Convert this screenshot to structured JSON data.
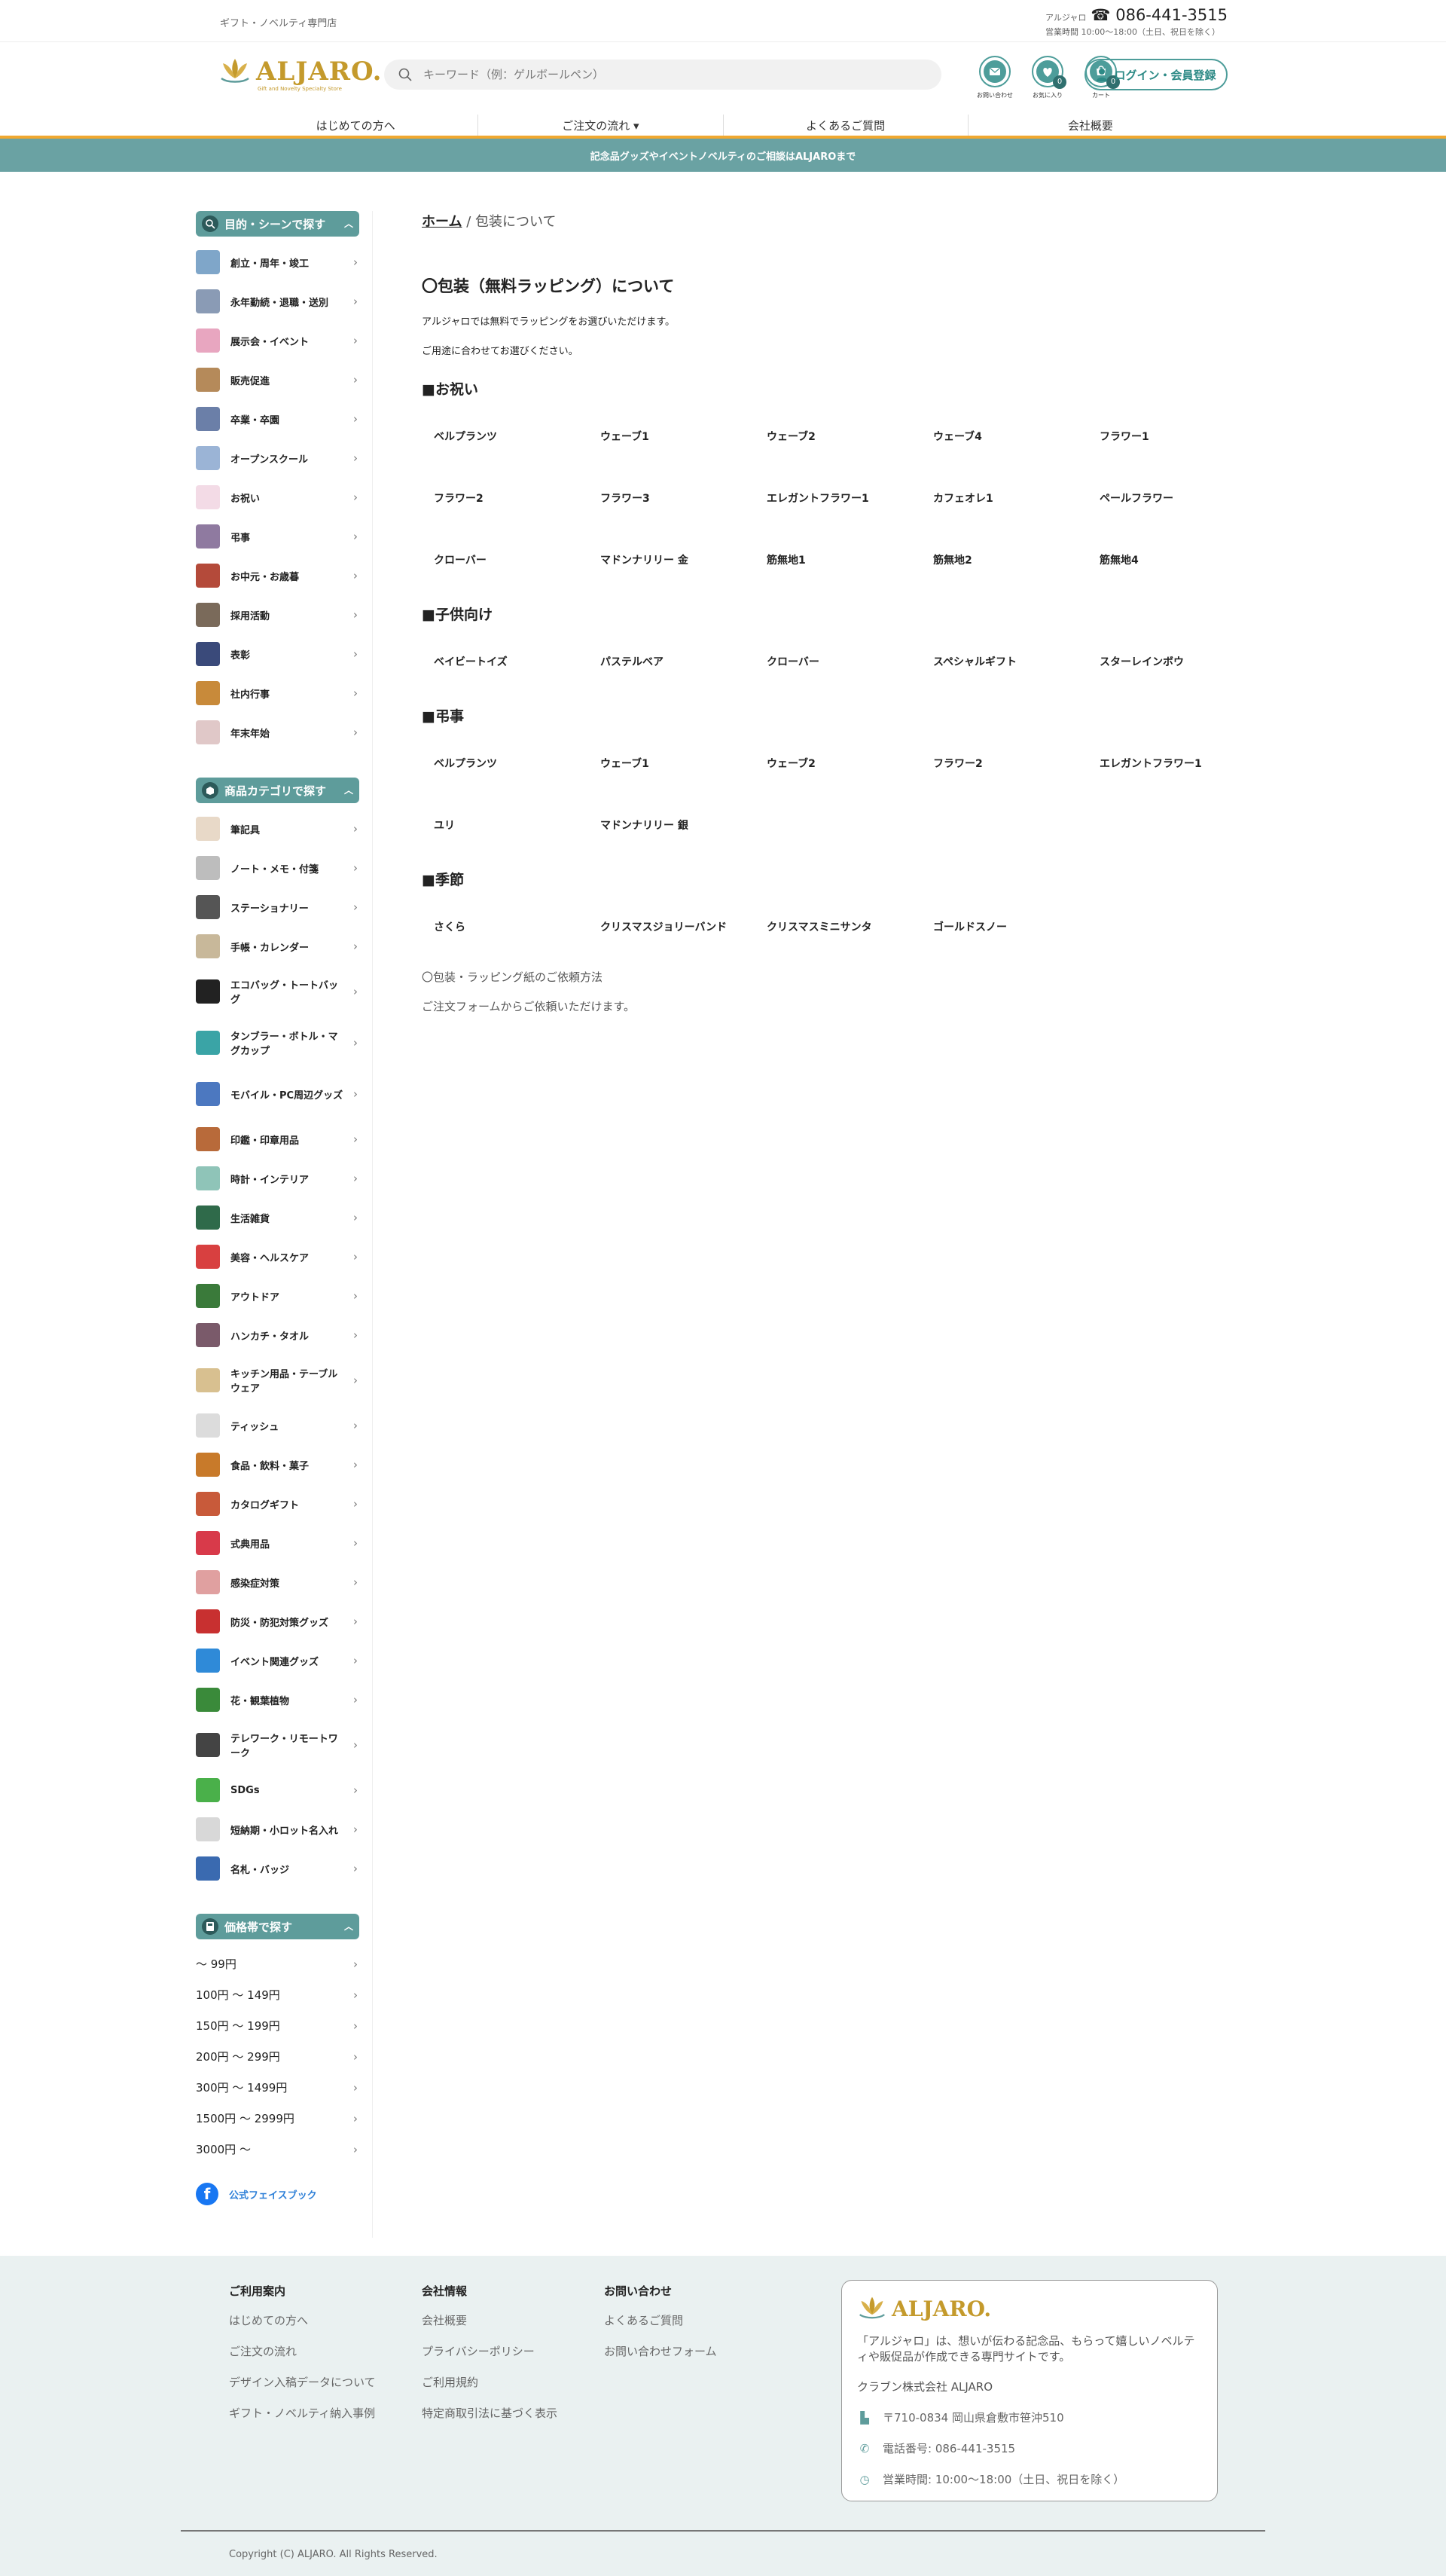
{
  "topbar": {
    "tagline": "ギフト・ノベルティ専門店",
    "phone_prefix": "アルジャロ",
    "phone": "☎ 086-441-3515",
    "hours": "営業時間 10:00〜18:00（土日、祝日を除く）"
  },
  "header": {
    "logo_text": "ALJARO.",
    "logo_sub": "Gift and Novelty Specialty Store",
    "search_placeholder": "キーワード（例：ゲルボールペン）",
    "icons": [
      {
        "label": "お問い合わせ",
        "icon": "mail-icon"
      },
      {
        "label": "お気に入り",
        "icon": "heart-icon",
        "count": "0"
      },
      {
        "label": "カート",
        "icon": "cart-icon",
        "count": "0"
      }
    ],
    "login_label": "ログイン・会員登録"
  },
  "nav": [
    "はじめての方へ",
    "ご注文の流れ ▾",
    "よくあるご質問",
    "会社概要"
  ],
  "banner": "記念品グッズやイベントノベルティのご相談はALJAROまで",
  "sidebar": {
    "scene_title": "目的・シーンで探す",
    "scenes": [
      "創立・周年・竣工",
      "永年勤続・退職・送別",
      "展示会・イベント",
      "販売促進",
      "卒業・卒園",
      "オープンスクール",
      "お祝い",
      "弔事",
      "お中元・お歳暮",
      "採用活動",
      "表彰",
      "社内行事",
      "年末年始"
    ],
    "category_title": "商品カテゴリで探す",
    "categories": [
      "筆記具",
      "ノート・メモ・付箋",
      "ステーショナリー",
      "手帳・カレンダー",
      "エコバッグ・トートバッグ",
      "タンブラー・ボトル・マグカップ",
      "モバイル・PC周辺グッズ",
      "印鑑・印章用品",
      "時計・インテリア",
      "生活雑貨",
      "美容・ヘルスケア",
      "アウトドア",
      "ハンカチ・タオル",
      "キッチン用品・テーブルウェア",
      "ティッシュ",
      "食品・飲料・菓子",
      "カタログギフト",
      "式典用品",
      "感染症対策",
      "防災・防犯対策グッズ",
      "イベント関連グッズ",
      "花・観葉植物",
      "テレワーク・リモートワーク",
      "SDGs",
      "短納期・小ロット名入れ",
      "名札・バッジ"
    ],
    "price_title": "価格帯で探す",
    "prices": [
      "〜 99円",
      "100円 〜 149円",
      "150円 〜 199円",
      "200円 〜 299円",
      "300円 〜 1499円",
      "1500円 〜 2999円",
      "3000円 〜"
    ],
    "facebook": "公式フェイスブック"
  },
  "content": {
    "breadcrumb_home": "ホーム",
    "breadcrumb_current": "/ 包装について",
    "title": "〇包装（無料ラッピング）について",
    "intro1": "アルジャロでは無料でラッピングをお選びいただけます。",
    "intro2": "ご用途に合わせてお選びください。",
    "sections": [
      {
        "title": "■お祝い",
        "items": [
          "ベルプランツ",
          "ウェーブ1",
          "ウェーブ2",
          "ウェーブ4",
          "フラワー1",
          "フラワー2",
          "フラワー3",
          "エレガントフラワー1",
          "カフェオレ1",
          "ペールフラワー",
          "クローバー",
          "マドンナリリー 金",
          "筋無地1",
          "筋無地2",
          "筋無地4"
        ]
      },
      {
        "title": "■子供向け",
        "items": [
          "ベイビートイズ",
          "パステルベア",
          "クローバー",
          "スペシャルギフト",
          "スターレインボウ"
        ]
      },
      {
        "title": "■弔事",
        "items": [
          "ベルプランツ",
          "ウェーブ1",
          "ウェーブ2",
          "フラワー2",
          "エレガントフラワー1",
          "ユリ",
          "マドンナリリー 銀"
        ]
      },
      {
        "title": "■季節",
        "items": [
          "さくら",
          "クリスマスジョリーバンド",
          "クリスマスミニサンタ",
          "ゴールドスノー"
        ]
      }
    ],
    "note1": "〇包装・ラッピング紙のご依頼方法",
    "note2": "ご注文フォームからご依頼いただけます。"
  },
  "footer": {
    "cols": [
      {
        "title": "ご利用案内",
        "links": [
          "はじめての方へ",
          "ご注文の流れ",
          "デザイン入稿データについて",
          "ギフト・ノベルティ納入事例"
        ]
      },
      {
        "title": "会社情報",
        "links": [
          "会社概要",
          "プライバシーポリシー",
          "ご利用規約",
          "特定商取引法に基づく表示"
        ]
      },
      {
        "title": "お問い合わせ",
        "links": [
          "よくあるご質問",
          "お問い合わせフォーム"
        ]
      }
    ],
    "box": {
      "logo_text": "ALJARO.",
      "desc": "「アルジャロ」は、想いが伝わる記念品、もらって嬉しいノベルティや販促品が作成できる専門サイトです。",
      "company": "クラブン株式会社 ALJARO",
      "address": "〒710-0834 岡山県倉敷市笹沖510",
      "tel": "電話番号: 086-441-3515",
      "hours": "営業時間: 10:00〜18:00（土日、祝日を除く）"
    },
    "copyright": "Copyright (C) ALJARO. All Rights Reserved."
  },
  "colors": {
    "accent": "#5e9c9b",
    "nav_underline": "#f0a830",
    "banner": "#6aa2a3",
    "logo_gold": "#c49a2c",
    "footer_bg": "#eaf1f1"
  }
}
